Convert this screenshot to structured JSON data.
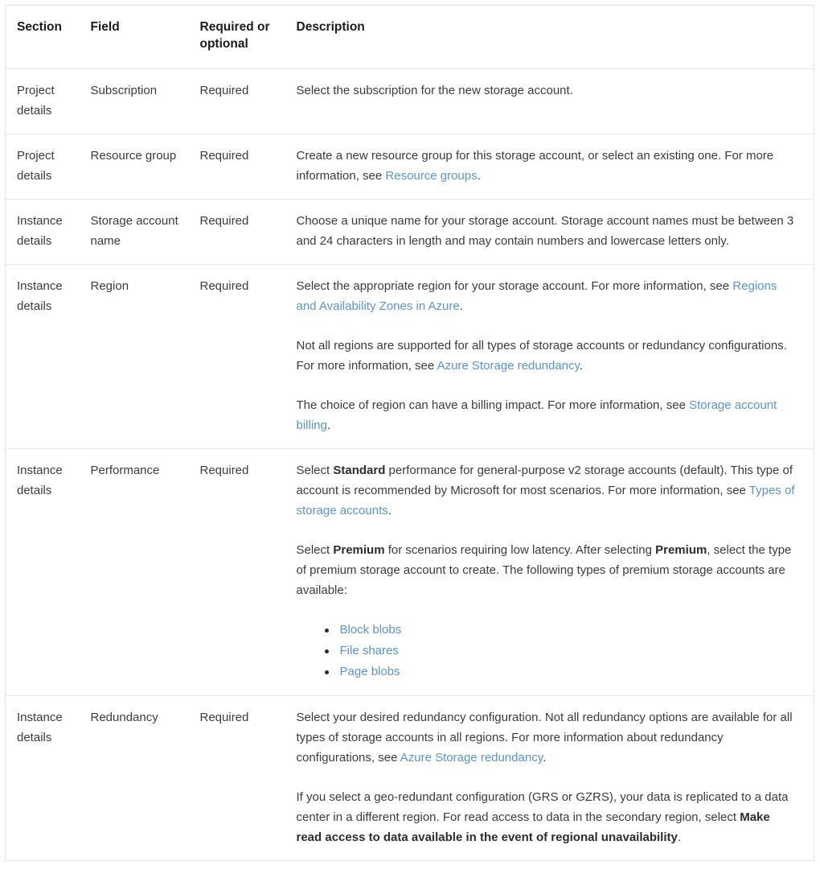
{
  "table": {
    "columns": [
      {
        "key": "section",
        "label": "Section"
      },
      {
        "key": "field",
        "label": "Field"
      },
      {
        "key": "required",
        "label": "Required or optional"
      },
      {
        "key": "desc",
        "label": "Description"
      }
    ],
    "rows": [
      {
        "section": "Project details",
        "field": "Subscription",
        "required": "Required",
        "paragraphs": [
          {
            "pre": "Select the subscription for the new storage account."
          }
        ]
      },
      {
        "section": "Project details",
        "field": "Resource group",
        "required": "Required",
        "paragraphs": [
          {
            "pre": "Create a new resource group for this storage account, or select an existing one. For more information, see ",
            "link": "Resource groups",
            "post": "."
          }
        ]
      },
      {
        "section": "Instance details",
        "field": "Storage account name",
        "required": "Required",
        "paragraphs": [
          {
            "pre": "Choose a unique name for your storage account. Storage account names must be between 3 and 24 characters in length and may contain numbers and lowercase letters only."
          }
        ]
      },
      {
        "section": "Instance details",
        "field": "Region",
        "required": "Required",
        "paragraphs": [
          {
            "pre": "Select the appropriate region for your storage account. For more information, see ",
            "link": "Regions and Availability Zones in Azure",
            "post": "."
          },
          {
            "pre": "Not all regions are supported for all types of storage accounts or redundancy configurations. For more information, see ",
            "link": "Azure Storage redundancy",
            "post": "."
          },
          {
            "pre": "The choice of region can have a billing impact. For more information, see ",
            "link": "Storage account billing",
            "post": "."
          }
        ]
      },
      {
        "section": "Instance details",
        "field": "Performance",
        "required": "Required",
        "paragraphs": [
          {
            "pre": "Select ",
            "bold": "Standard",
            "mid": " performance for general-purpose v2 storage accounts (default). This type of account is recommended by Microsoft for most scenarios. For more information, see ",
            "link": "Types of storage accounts",
            "post": "."
          },
          {
            "pre": "Select ",
            "bold": "Premium",
            "mid": " for scenarios requiring low latency. After selecting ",
            "bold2": "Premium",
            "post": ", select the type of premium storage account to create. The following types of premium storage accounts are available:"
          }
        ],
        "bullets": [
          "Block blobs",
          "File shares",
          "Page blobs"
        ]
      },
      {
        "section": "Instance details",
        "field": "Redundancy",
        "required": "Required",
        "paragraphs": [
          {
            "pre": "Select your desired redundancy configuration. Not all redundancy options are available for all types of storage accounts in all regions. For more information about redundancy configurations, see ",
            "link": "Azure Storage redundancy",
            "post": "."
          },
          {
            "pre": "If you select a geo-redundant configuration (GRS or GZRS), your data is replicated to a data center in a different region. For read access to data in the secondary region, select ",
            "bold": "Make read access to data available in the event of regional unavailability",
            "post": "."
          }
        ]
      }
    ]
  },
  "colors": {
    "link": "#5a93d4",
    "text": "#3b3b3b",
    "heading": "#1b1b1b",
    "border": "#e3e3e3",
    "background": "#ffffff"
  }
}
